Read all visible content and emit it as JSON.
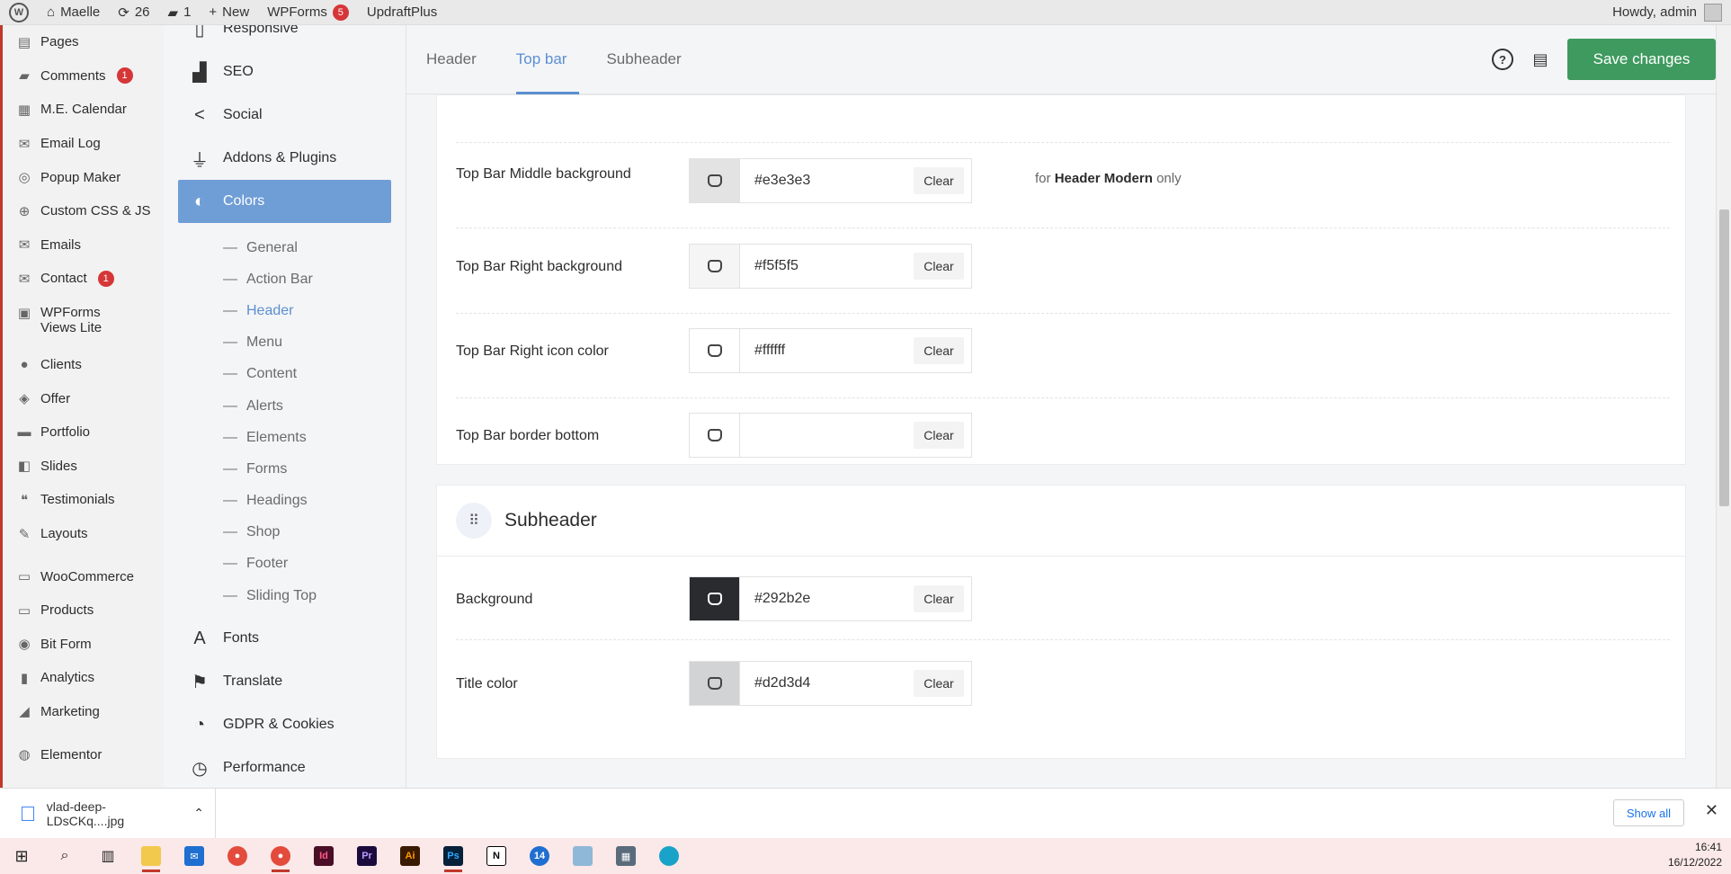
{
  "adminbar": {
    "site_name": "Maelle",
    "updates_count": "26",
    "comments_count": "1",
    "new_label": "New",
    "wpforms_label": "WPForms",
    "wpforms_count": "5",
    "updraft_label": "UpdraftPlus",
    "howdy": "Howdy, admin"
  },
  "wpmenu": {
    "items": [
      {
        "label": "Pages",
        "icon": "pages-icon",
        "badge": ""
      },
      {
        "label": "Comments",
        "icon": "comments-icon",
        "badge": "1"
      },
      {
        "label": "M.E. Calendar",
        "icon": "calendar-icon",
        "badge": ""
      },
      {
        "label": "Email Log",
        "icon": "email-icon",
        "badge": ""
      },
      {
        "label": "Popup Maker",
        "icon": "popup-icon",
        "badge": ""
      },
      {
        "label": "Custom CSS & JS",
        "icon": "plus-circle-icon",
        "badge": ""
      },
      {
        "label": "Emails",
        "icon": "email-icon",
        "badge": ""
      },
      {
        "label": "Contact",
        "icon": "email-icon",
        "badge": "1"
      },
      {
        "label": "WPForms Views Lite",
        "icon": "forms-icon",
        "badge": ""
      },
      {
        "label": "Clients",
        "icon": "user-icon",
        "badge": ""
      },
      {
        "label": "Offer",
        "icon": "tag-icon",
        "badge": ""
      },
      {
        "label": "Portfolio",
        "icon": "portfolio-icon",
        "badge": ""
      },
      {
        "label": "Slides",
        "icon": "slides-icon",
        "badge": ""
      },
      {
        "label": "Testimonials",
        "icon": "quote-icon",
        "badge": ""
      },
      {
        "label": "Layouts",
        "icon": "brush-icon",
        "badge": ""
      },
      {
        "label": "WooCommerce",
        "icon": "woo-icon",
        "badge": ""
      },
      {
        "label": "Products",
        "icon": "archive-icon",
        "badge": ""
      },
      {
        "label": "Bit Form",
        "icon": "bitform-icon",
        "badge": ""
      },
      {
        "label": "Analytics",
        "icon": "chart-icon",
        "badge": ""
      },
      {
        "label": "Marketing",
        "icon": "megaphone-icon",
        "badge": ""
      },
      {
        "label": "Elementor",
        "icon": "elementor-icon",
        "badge": ""
      }
    ]
  },
  "optnav": {
    "top": [
      {
        "label": "Responsive",
        "icon": "responsive-icon"
      },
      {
        "label": "SEO",
        "icon": "seo-icon"
      },
      {
        "label": "Social",
        "icon": "share-icon"
      },
      {
        "label": "Addons & Plugins",
        "icon": "plug-icon"
      },
      {
        "label": "Colors",
        "icon": "palette-icon"
      }
    ],
    "sub": [
      {
        "label": "General"
      },
      {
        "label": "Action Bar"
      },
      {
        "label": "Header"
      },
      {
        "label": "Menu"
      },
      {
        "label": "Content"
      },
      {
        "label": "Alerts"
      },
      {
        "label": "Elements"
      },
      {
        "label": "Forms"
      },
      {
        "label": "Headings"
      },
      {
        "label": "Shop"
      },
      {
        "label": "Footer"
      },
      {
        "label": "Sliding Top"
      }
    ],
    "bottom": [
      {
        "label": "Fonts",
        "icon": "font-icon"
      },
      {
        "label": "Translate",
        "icon": "flag-icon"
      },
      {
        "label": "GDPR & Cookies",
        "icon": "cookie-icon"
      },
      {
        "label": "Performance",
        "icon": "performance-icon"
      }
    ],
    "dash": "—"
  },
  "tabs": {
    "items": [
      {
        "label": "Header"
      },
      {
        "label": "Top bar"
      },
      {
        "label": "Subheader"
      }
    ],
    "help_glyph": "?",
    "notes_glyph": "▤",
    "save_label": "Save changes"
  },
  "topbar_section": {
    "rows": [
      {
        "label": "Top Bar Middle background",
        "value": "#e3e3e3",
        "swatch": "#e3e3e3",
        "clear": "Clear",
        "note_prefix": "for",
        "note_bold": "Header Modern",
        "note_suffix": "only"
      },
      {
        "label": "Top Bar Right background",
        "value": "#f5f5f5",
        "swatch": "#f5f5f5",
        "clear": "Clear"
      },
      {
        "label": "Top Bar Right icon color",
        "value": "#ffffff",
        "swatch": "#ffffff",
        "clear": "Clear"
      },
      {
        "label": "Top Bar border bottom",
        "value": "",
        "swatch": "#ffffff",
        "clear": "Clear"
      }
    ]
  },
  "subheader_section": {
    "title": "Subheader",
    "icon": "grid-dots-icon",
    "rows": [
      {
        "label": "Background",
        "value": "#292b2e",
        "swatch": "#292b2e",
        "clear": "Clear"
      },
      {
        "label": "Title color",
        "value": "#d2d3d4",
        "swatch": "#d2d3d4",
        "clear": "Clear"
      }
    ]
  },
  "download": {
    "filename": "vlad-deep-LDsCKq....jpg",
    "show_all": "Show all"
  },
  "taskbar": {
    "time": "16:41",
    "date": "16/12/2022",
    "chrome_badge": "14"
  },
  "colors": {
    "accent": "#5b8fd1",
    "active_nav": "#6f9dd6",
    "save": "#3f9a5f",
    "badge": "#d63638"
  }
}
